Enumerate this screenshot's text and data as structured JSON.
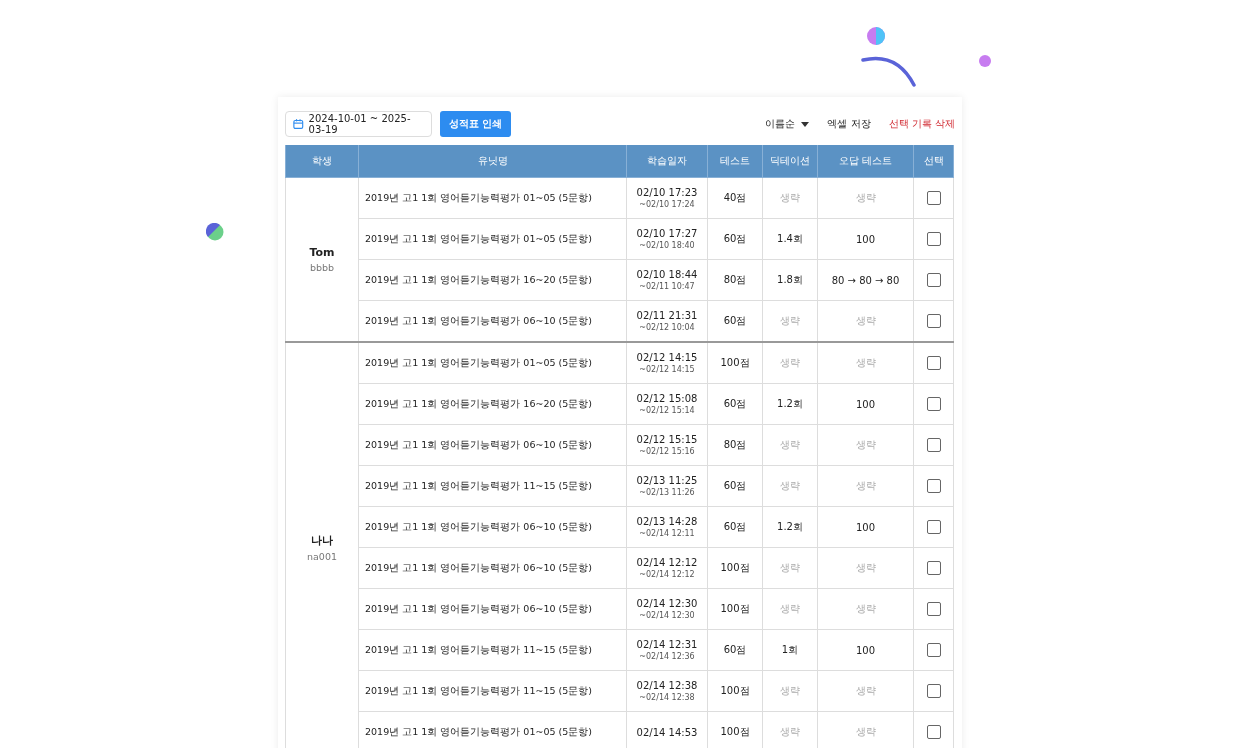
{
  "toolbar": {
    "date_range": "2024-10-01 ~ 2025-03-19",
    "print_button": "성적표 인쇄",
    "sort": "이름순",
    "excel_button": "엑셀 저장",
    "delete_button": "선택 기록 삭제"
  },
  "table": {
    "columns": [
      "학생",
      "유닛명",
      "학습일자",
      "테스트",
      "딕테이션",
      "오답 테스트",
      "선택"
    ],
    "groups": [
      {
        "name": "Tom",
        "id": "bbbb",
        "rows": [
          {
            "unit": "2019년 고1 1회 영어듣기능력평가 01~05 (5문항)",
            "start": "02/10 17:23",
            "end": "~02/10 17:24",
            "test": "40점",
            "dictation": "생략",
            "dictation_omitted": true,
            "retest": "생략",
            "retest_omitted": true,
            "checked": false
          },
          {
            "unit": "2019년 고1 1회 영어듣기능력평가 01~05 (5문항)",
            "start": "02/10 17:27",
            "end": "~02/10 18:40",
            "test": "60점",
            "dictation": "1.4회",
            "dictation_omitted": false,
            "retest": "100",
            "retest_omitted": false,
            "checked": false
          },
          {
            "unit": "2019년 고1 1회 영어듣기능력평가 16~20 (5문항)",
            "start": "02/10 18:44",
            "end": "~02/11 10:47",
            "test": "80점",
            "dictation": "1.8회",
            "dictation_omitted": false,
            "retest": "80 → 80 → 80",
            "retest_omitted": false,
            "checked": false
          },
          {
            "unit": "2019년 고1 1회 영어듣기능력평가 06~10 (5문항)",
            "start": "02/11 21:31",
            "end": "~02/12 10:04",
            "test": "60점",
            "dictation": "생략",
            "dictation_omitted": true,
            "retest": "생략",
            "retest_omitted": true,
            "checked": false
          }
        ]
      },
      {
        "name": "나나",
        "id": "na001",
        "rows": [
          {
            "unit": "2019년 고1 1회 영어듣기능력평가 01~05 (5문항)",
            "start": "02/12 14:15",
            "end": "~02/12 14:15",
            "test": "100점",
            "dictation": "생략",
            "dictation_omitted": true,
            "retest": "생략",
            "retest_omitted": true,
            "checked": false
          },
          {
            "unit": "2019년 고1 1회 영어듣기능력평가 16~20 (5문항)",
            "start": "02/12 15:08",
            "end": "~02/12 15:14",
            "test": "60점",
            "dictation": "1.2회",
            "dictation_omitted": false,
            "retest": "100",
            "retest_omitted": false,
            "checked": false
          },
          {
            "unit": "2019년 고1 1회 영어듣기능력평가 06~10 (5문항)",
            "start": "02/12 15:15",
            "end": "~02/12 15:16",
            "test": "80점",
            "dictation": "생략",
            "dictation_omitted": true,
            "retest": "생략",
            "retest_omitted": true,
            "checked": false
          },
          {
            "unit": "2019년 고1 1회 영어듣기능력평가 11~15 (5문항)",
            "start": "02/13 11:25",
            "end": "~02/13 11:26",
            "test": "60점",
            "dictation": "생략",
            "dictation_omitted": true,
            "retest": "생략",
            "retest_omitted": true,
            "checked": false
          },
          {
            "unit": "2019년 고1 1회 영어듣기능력평가 06~10 (5문항)",
            "start": "02/13 14:28",
            "end": "~02/14 12:11",
            "test": "60점",
            "dictation": "1.2회",
            "dictation_omitted": false,
            "retest": "100",
            "retest_omitted": false,
            "checked": false
          },
          {
            "unit": "2019년 고1 1회 영어듣기능력평가 06~10 (5문항)",
            "start": "02/14 12:12",
            "end": "~02/14 12:12",
            "test": "100점",
            "dictation": "생략",
            "dictation_omitted": true,
            "retest": "생략",
            "retest_omitted": true,
            "checked": false
          },
          {
            "unit": "2019년 고1 1회 영어듣기능력평가 06~10 (5문항)",
            "start": "02/14 12:30",
            "end": "~02/14 12:30",
            "test": "100점",
            "dictation": "생략",
            "dictation_omitted": true,
            "retest": "생략",
            "retest_omitted": true,
            "checked": false
          },
          {
            "unit": "2019년 고1 1회 영어듣기능력평가 11~15 (5문항)",
            "start": "02/14 12:31",
            "end": "~02/14 12:36",
            "test": "60점",
            "dictation": "1회",
            "dictation_omitted": false,
            "retest": "100",
            "retest_omitted": false,
            "checked": false
          },
          {
            "unit": "2019년 고1 1회 영어듣기능력평가 11~15 (5문항)",
            "start": "02/14 12:38",
            "end": "~02/14 12:38",
            "test": "100점",
            "dictation": "생략",
            "dictation_omitted": true,
            "retest": "생략",
            "retest_omitted": true,
            "checked": false
          },
          {
            "unit": "2019년 고1 1회 영어듣기능력평가 01~05 (5문항)",
            "start": "02/14 14:53",
            "test": "100점",
            "dictation": "생략",
            "dictation_omitted": true,
            "retest": "생략",
            "retest_omitted": true,
            "checked": false
          }
        ]
      }
    ]
  }
}
